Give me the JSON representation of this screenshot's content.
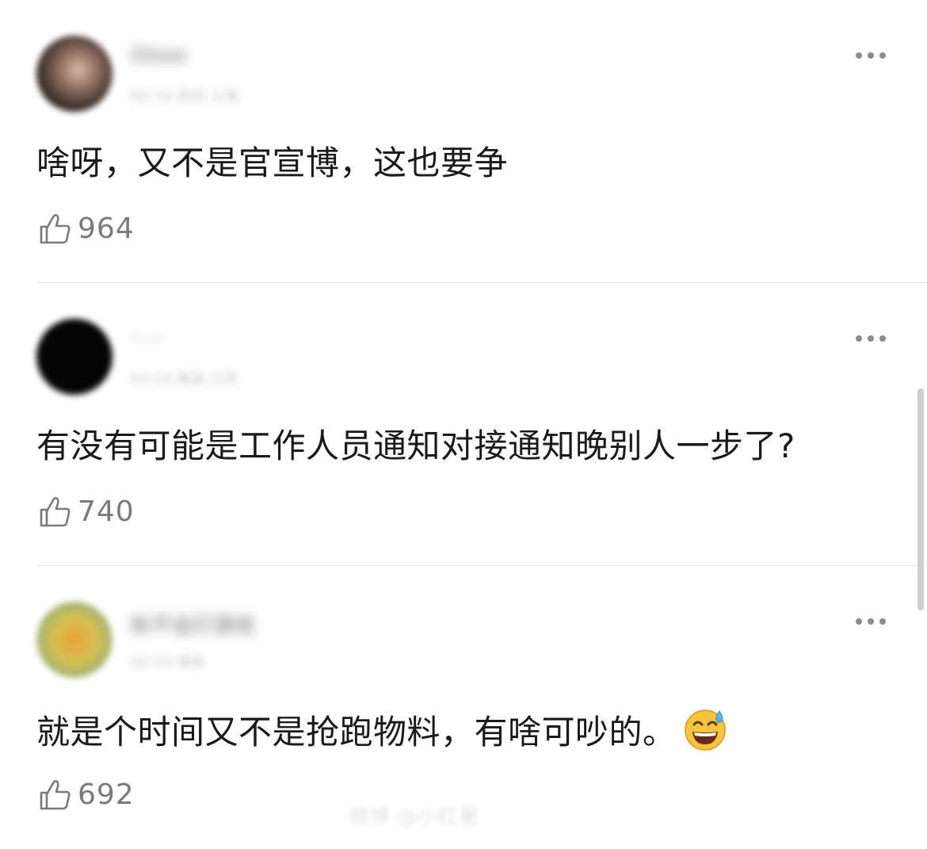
{
  "comments": [
    {
      "username": "Glsso",
      "meta": "02-14 来自 上海",
      "text": "啥呀，又不是官宣博，这也要争",
      "likes": "964",
      "emoji": ""
    },
    {
      "username": "·· ··",
      "meta": "02-14 来自 江苏",
      "text": "有没有可能是工作人员通知对接通知晚别人一步了?",
      "likes": "740",
      "emoji": ""
    },
    {
      "username": "秋不会打游戏",
      "meta": "02-14 来自",
      "text": "就是个时间又不是抢跑物料，有啥可吵的。",
      "likes": "692",
      "emoji": "grinning-sweat-emoji"
    }
  ],
  "watermark": "微博 @小红薯"
}
